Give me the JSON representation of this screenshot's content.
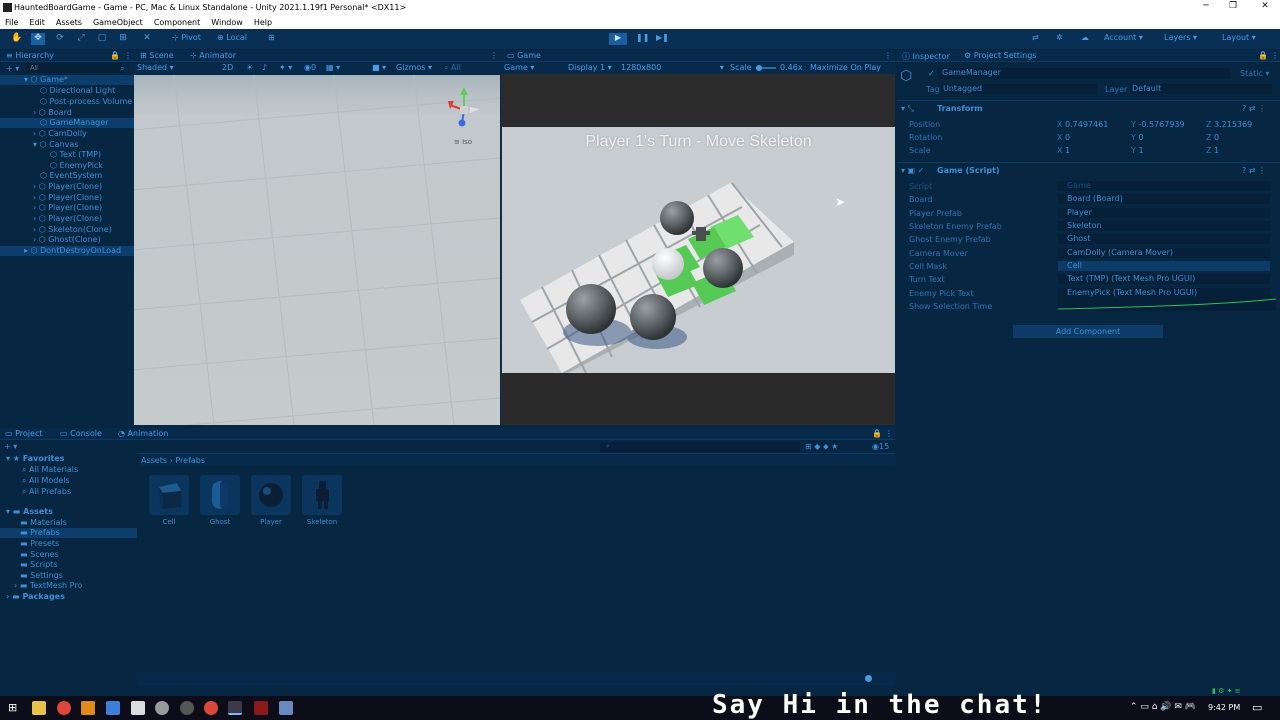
{
  "window": {
    "title": "HauntedBoardGame - Game - PC, Mac & Linux Standalone - Unity 2021.1.19f1 Personal* <DX11>"
  },
  "menu": [
    "File",
    "Edit",
    "Assets",
    "GameObject",
    "Component",
    "Window",
    "Help"
  ],
  "toolbar": {
    "pivot": "Pivot",
    "local": "Local",
    "account": "Account",
    "layers": "Layers",
    "layout": "Layout"
  },
  "hierarchy": {
    "tab": "Hierarchy",
    "search_placeholder": "All",
    "items": [
      "Game*",
      "Directional Light",
      "Post-process Volume",
      "Board",
      "GameManager",
      "CamDolly",
      "Canvas",
      "Text (TMP)",
      "EnemyPick",
      "EventSystem",
      "Player(Clone)",
      "Player(Clone)",
      "Player(Clone)",
      "Player(Clone)",
      "Skeleton(Clone)",
      "Ghost(Clone)",
      "DontDestroyOnLoad"
    ]
  },
  "scene": {
    "tabs": [
      "Scene",
      "Animator"
    ],
    "shading": "Shaded",
    "mode2d": "2D",
    "gizmos": "Gizmos",
    "search": "All",
    "iso": "Iso"
  },
  "game": {
    "tab": "Game",
    "display_mode": "Game",
    "display": "Display 1",
    "resolution": "1280x800",
    "scale_label": "Scale",
    "scale_value": "0.46x",
    "maximize": "Maximize On Play",
    "turn_text": "Player 1's Turn - Move Skeleton"
  },
  "inspector": {
    "tabs": [
      "Inspector",
      "Project Settings"
    ],
    "object_name": "GameManager",
    "static_label": "Static",
    "tag_label": "Tag",
    "tag_value": "Untagged",
    "layer_label": "Layer",
    "layer_value": "Default",
    "transform": {
      "title": "Transform",
      "position_label": "Position",
      "rotation_label": "Rotation",
      "scale_label": "Scale",
      "position": {
        "x": "0.7497461",
        "y": "-0.5767939",
        "z": "3.215369"
      },
      "rotation": {
        "x": "0",
        "y": "0",
        "z": "0"
      },
      "scale": {
        "x": "1",
        "y": "1",
        "z": "1"
      }
    },
    "script": {
      "title": "Game (Script)",
      "fields": [
        {
          "label": "Script",
          "value": "Game"
        },
        {
          "label": "Board",
          "value": "Board (Board)"
        },
        {
          "label": "Player Prefab",
          "value": "Player"
        },
        {
          "label": "Skeleton Enemy Prefab",
          "value": "Skeleton"
        },
        {
          "label": "Ghost Enemy Prefab",
          "value": "Ghost"
        },
        {
          "label": "Camera Mover",
          "value": "CamDolly (Camera Mover)"
        },
        {
          "label": "Cell Mask",
          "value": "Cell"
        },
        {
          "label": "Turn Text",
          "value": "Text (TMP) (Text Mesh Pro UGUI)"
        },
        {
          "label": "Enemy Pick Text",
          "value": "EnemyPick (Text Mesh Pro UGUI)"
        },
        {
          "label": "Show Selection Time",
          "value": ""
        }
      ]
    },
    "add_component": "Add Component"
  },
  "project": {
    "tabs": [
      "Project",
      "Console",
      "Animation"
    ],
    "favorites_label": "Favorites",
    "favorites": [
      "All Materials",
      "All Models",
      "All Prefabs"
    ],
    "assets_label": "Assets",
    "folders": [
      "Materials",
      "Prefabs",
      "Presets",
      "Scenes",
      "Scripts",
      "Settings",
      "TextMesh Pro"
    ],
    "packages_label": "Packages",
    "breadcrumb": [
      "Assets",
      "Prefabs"
    ],
    "prefabs": [
      "Cell",
      "Ghost",
      "Player",
      "Skeleton"
    ],
    "count": "15"
  },
  "overlay": {
    "chat": "Say Hi in the chat!"
  },
  "taskbar": {
    "time": "9:42 PM"
  }
}
